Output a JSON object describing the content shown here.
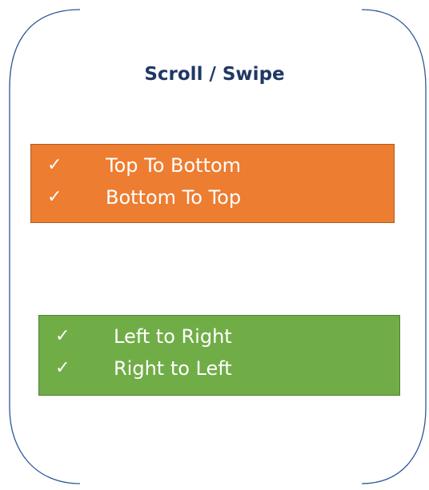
{
  "title": "Scroll / Swipe",
  "colors": {
    "frame": "#2f5597",
    "title": "#203864",
    "vertical_box": "#ed7d31",
    "horizontal_box": "#70ad47"
  },
  "vertical_group": {
    "items": [
      {
        "check": "✓",
        "label": "Top To Bottom"
      },
      {
        "check": "✓",
        "label": "Bottom To Top"
      }
    ]
  },
  "horizontal_group": {
    "items": [
      {
        "check": "✓",
        "label": "Left to Right"
      },
      {
        "check": "✓",
        "label": "Right to Left"
      }
    ]
  }
}
